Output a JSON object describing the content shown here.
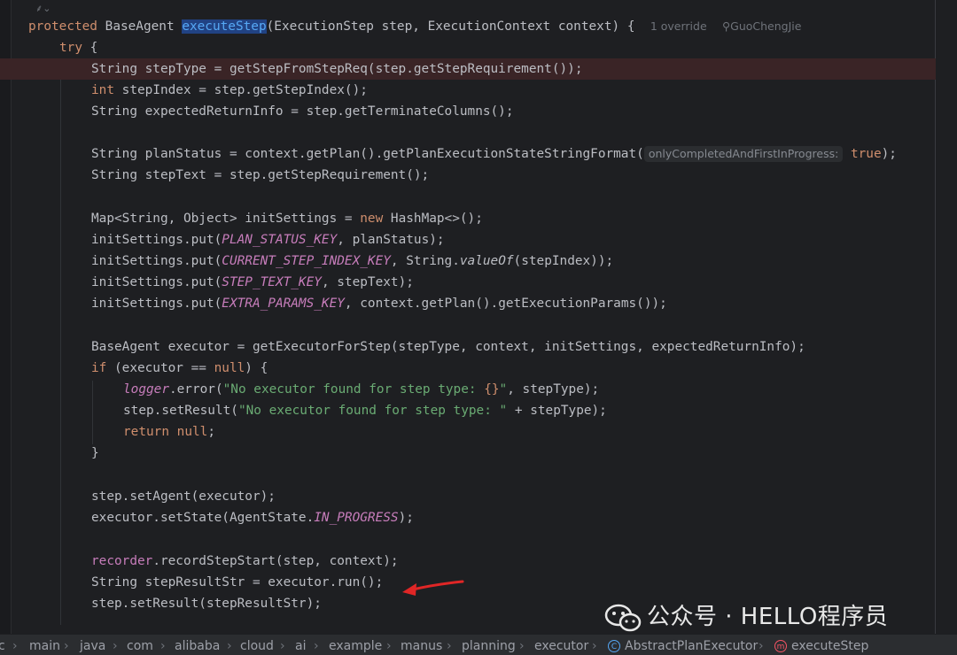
{
  "editor": {
    "method_signature": {
      "modifier": "protected",
      "type": "BaseAgent",
      "name": "executeStep",
      "params": "(ExecutionStep step, ExecutionContext context) {",
      "overrides": "1 override",
      "author": "GuoChengJie"
    },
    "lines": {
      "l2": "try",
      "l3a": "String stepType = getStepFromStepReq(step.getStepRequirement());",
      "l4a": "int",
      "l4b": " stepIndex = step.getStepIndex();",
      "l5": "String expectedReturnInfo = step.getTerminateColumns();",
      "l7a": "String planStatus = context.getPlan().getPlanExecutionStateStringFormat(",
      "l7hint": "onlyCompletedAndFirstInProgress:",
      "l7b": "true",
      "l7c": ");",
      "l8": "String stepText = step.getStepRequirement();",
      "l10a": "Map<String, Object> initSettings = ",
      "l10b": "new",
      "l10c": " HashMap<>();",
      "l11a": "initSettings.put(",
      "l11b": "PLAN_STATUS_KEY",
      "l11c": ", planStatus);",
      "l12a": "initSettings.put(",
      "l12b": "CURRENT_STEP_INDEX_KEY",
      "l12c": ", String.",
      "l12d": "valueOf",
      "l12e": "(stepIndex));",
      "l13a": "initSettings.put(",
      "l13b": "STEP_TEXT_KEY",
      "l13c": ", stepText);",
      "l14a": "initSettings.put(",
      "l14b": "EXTRA_PARAMS_KEY",
      "l14c": ", context.getPlan().getExecutionParams());",
      "l16": "BaseAgent executor = getExecutorForStep(stepType, context, initSettings, expectedReturnInfo);",
      "l17a": "if",
      "l17b": " (executor == ",
      "l17c": "null",
      "l17d": ") {",
      "l18a": "logger",
      "l18b": ".error(",
      "l18c": "\"No executor found for step type: ",
      "l18d": "{}",
      "l18e": "\"",
      "l18f": ", stepType);",
      "l19a": "step.setResult(",
      "l19b": "\"No executor found for step type: \"",
      "l19c": " + stepType);",
      "l20a": "return",
      "l20b": "null",
      "l20c": ";",
      "l21": "}",
      "l23": "step.setAgent(executor);",
      "l24a": "executor.setState(AgentState.",
      "l24b": "IN_PROGRESS",
      "l24c": ");",
      "l26a": "recorder",
      "l26b": ".recordStepStart(step, context);",
      "l27": "String stepResultStr = executor.run();",
      "l28": "step.setResult(stepResultStr);"
    }
  },
  "breadcrumbs": [
    "c",
    "main",
    "java",
    "com",
    "alibaba",
    "cloud",
    "ai",
    "example",
    "manus",
    "planning",
    "executor",
    "AbstractPlanExecutor",
    "executeStep"
  ],
  "watermark": "公众号 · HELLO程序员",
  "colors": {
    "background": "#1e1f22",
    "keyword": "#cf8e6d",
    "function": "#56a8f5",
    "constant": "#c77dbb",
    "string": "#6aab73",
    "arrow": "#e02626"
  }
}
